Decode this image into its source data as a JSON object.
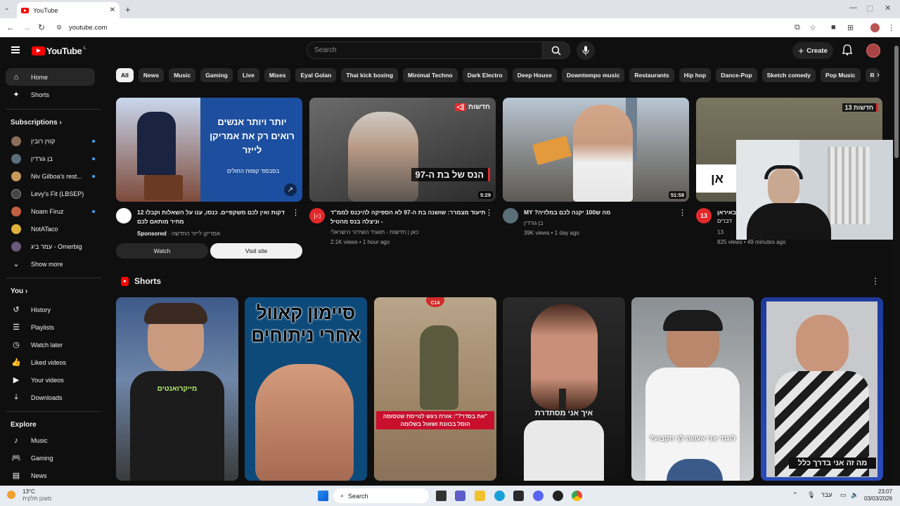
{
  "browser": {
    "tab_title": "YouTube",
    "url": "youtube.com"
  },
  "header": {
    "logo_text": "YouTube",
    "logo_country": "IL",
    "search_placeholder": "Search",
    "create_label": "Create"
  },
  "sidebar": {
    "home": "Home",
    "shorts": "Shorts",
    "subscriptions_title": "Subscriptions",
    "subscriptions": [
      {
        "name": "קווין רובין",
        "color": "#8a6d5a"
      },
      {
        "name": "בן גורדין",
        "color": "#5b6f7a"
      },
      {
        "name": "Niv Gilboa's rest...",
        "color": "#c79a5b"
      },
      {
        "name": "Levy's Fit (LBSEP)",
        "color": "#444444"
      },
      {
        "name": "Noam Firuz",
        "color": "#c2603f"
      },
      {
        "name": "NotATaco",
        "color": "#e0b23a"
      },
      {
        "name": "עמר ביג - Omerbig",
        "color": "#6a5a7a"
      }
    ],
    "show_more": "Show more",
    "you_title": "You",
    "you_items": [
      "History",
      "Playlists",
      "Watch later",
      "Liked videos",
      "Your videos",
      "Downloads"
    ],
    "explore_title": "Explore",
    "explore_items": [
      "Music",
      "Gaming",
      "News"
    ]
  },
  "chips": [
    "All",
    "News",
    "Music",
    "Gaming",
    "Live",
    "Mixes",
    "Eyal Golan",
    "Thai kick boxing",
    "Minimal Techno",
    "Dark Electro",
    "Deep House",
    "Downtempo music",
    "Restaurants",
    "Hip hop",
    "Dance-Pop",
    "Sketch comedy",
    "Pop Music",
    "R"
  ],
  "videos": [
    {
      "title": "דקות ואין לכם משקפיים. כנסו, ענו על השאלות וקבלו 12 מחיר מותאם לכם",
      "channel": "אמריקן לייזר החדשה",
      "sponsored": "Sponsored",
      "thumb_text": "יותר ויותר אנשים רואים רק את אמריקן לייזר",
      "thumb_sub": "בסבסוד קופות החולים",
      "watch": "Watch",
      "visit": "Visit site"
    },
    {
      "title": "תיעוד מצמרר: שושנה בת ה-97 לא הספיקה להיכנס לממ\"ד - וניצלה בנס מהטיל",
      "channel": "כאן | חדשות - תאגיד השידור הישראלי",
      "views": "2.1K views • 1 hour ago",
      "duration": "5:29",
      "thumb_text": "הנס של בת ה-97",
      "badge": "חדשות"
    },
    {
      "title": "מה ש100 יקנה לכם במלזיה?",
      "title_prefix": "MY",
      "channel": "בן גורדין",
      "views": "39K views • 1 day ago",
      "duration": "51:58"
    },
    {
      "title": "באיראן",
      "channel": "13",
      "views": "825 views • 49 minutes ago",
      "badge": "חדשות 13",
      "thumb_text": "אן",
      "thumb_side": "דברים"
    }
  ],
  "shorts": {
    "title": "Shorts",
    "items": [
      {
        "caption": "מייקרואנטים"
      },
      {
        "caption": "סיימון קאוול אחרי ניתוחים"
      },
      {
        "caption": "\"את בסדר?\": אזרח ניגש לטייסת שטסוסה הוסל בכוונת ושאול בשלומה",
        "badge": "C14"
      },
      {
        "caption": "איך אני מסתדרת"
      },
      {
        "caption": "לוגסי אני אעשה לך תקבוע?"
      },
      {
        "caption": "מה זה אני בדרך כלל",
        "top": "מה זה אני בדרך כלל"
      }
    ]
  },
  "taskbar": {
    "temp": "13°C",
    "weather": "מעונן חלקית",
    "search": "Search",
    "lang": "עבר",
    "time": "23:07",
    "date": "03/03/2026"
  }
}
